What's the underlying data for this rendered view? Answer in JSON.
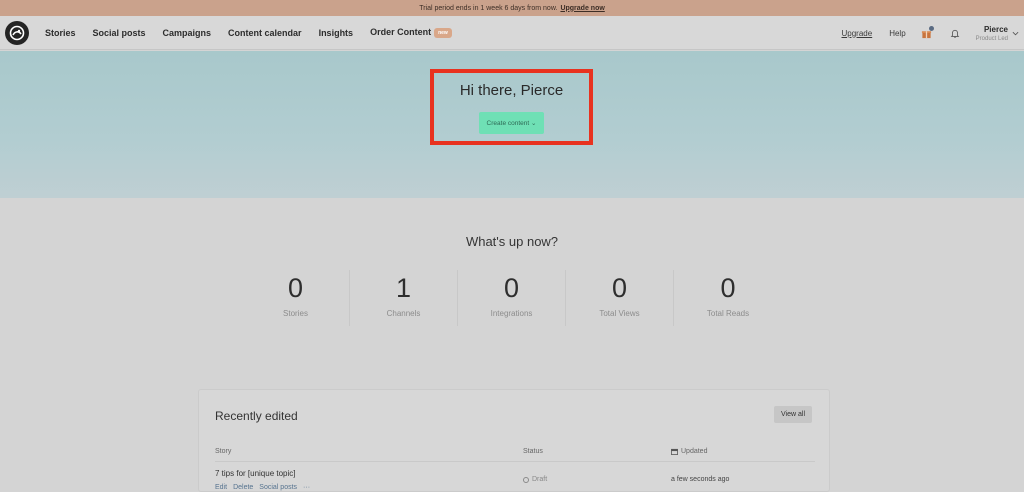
{
  "banner": {
    "message": "Trial period ends in 1 week 6 days from now.",
    "link": "Upgrade now"
  },
  "nav": {
    "items": [
      "Stories",
      "Social posts",
      "Campaigns",
      "Content calendar",
      "Insights",
      "Order Content"
    ],
    "new_badge": "new",
    "upgrade": "Upgrade",
    "help": "Help",
    "user_name": "Pierce",
    "user_role": "Product Led"
  },
  "hero": {
    "title": "Hi there, Pierce",
    "create_button": "Create content ⌄"
  },
  "whats_up": {
    "title": "What's up now?",
    "stats": [
      {
        "value": "0",
        "label": "Stories"
      },
      {
        "value": "1",
        "label": "Channels"
      },
      {
        "value": "0",
        "label": "Integrations"
      },
      {
        "value": "0",
        "label": "Total Views"
      },
      {
        "value": "0",
        "label": "Total Reads"
      }
    ]
  },
  "recent": {
    "title": "Recently edited",
    "view_all": "View all",
    "columns": {
      "story": "Story",
      "status": "Status",
      "updated": "Updated"
    },
    "rows": [
      {
        "title": "7 tips for [unique topic]",
        "actions": [
          "Edit",
          "Delete",
          "Social posts",
          "···"
        ],
        "status": "Draft",
        "updated": "a few seconds ago"
      }
    ]
  },
  "colors": {
    "banner": "#caa28c",
    "hero": "#a8c8cb",
    "highlight_border": "#e8321f",
    "create_button": "#6fe0b5",
    "badge": "#d9a789"
  }
}
